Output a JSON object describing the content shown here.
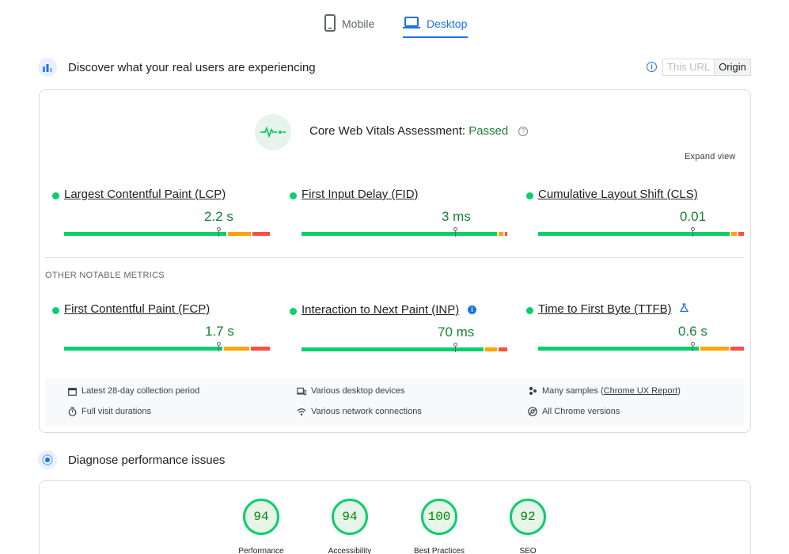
{
  "tabs": [
    {
      "label": "Mobile",
      "active": false
    },
    {
      "label": "Desktop",
      "active": true
    }
  ],
  "field": {
    "title": "Discover what your real users are experiencing",
    "toggle": {
      "url_label": "This URL",
      "origin_label": "Origin",
      "selected": "Origin"
    },
    "assessment": {
      "prefix": "Core Web Vitals Assessment: ",
      "status": "Passed"
    },
    "expand_label": "Expand view",
    "core_metrics": [
      {
        "name": "Largest Contentful Paint (LCP)",
        "value": "2.2 s",
        "status": "good"
      },
      {
        "name": "First Input Delay (FID)",
        "value": "3 ms",
        "status": "good"
      },
      {
        "name": "Cumulative Layout Shift (CLS)",
        "value": "0.01",
        "status": "good"
      }
    ],
    "other_label": "OTHER NOTABLE METRICS",
    "other_metrics": [
      {
        "name": "First Contentful Paint (FCP)",
        "value": "1.7 s",
        "status": "good"
      },
      {
        "name": "Interaction to Next Paint (INP)",
        "value": "70 ms",
        "status": "good",
        "icon": "info-icon"
      },
      {
        "name": "Time to First Byte (TTFB)",
        "value": "0.6 s",
        "status": "good",
        "icon": "experimental-flask-icon"
      }
    ],
    "footer": {
      "period": "Latest 28-day collection period",
      "devices": "Various desktop devices",
      "samples_prefix": "Many samples (",
      "samples_link": "Chrome UX Report",
      "samples_suffix": ")",
      "durations": "Full visit durations",
      "network": "Various network connections",
      "chrome": "All Chrome versions"
    }
  },
  "lab": {
    "title": "Diagnose performance issues",
    "scores": [
      {
        "label": "Performance",
        "score": "94"
      },
      {
        "label": "Accessibility",
        "score": "94"
      },
      {
        "label": "Best Practices",
        "score": "100"
      },
      {
        "label": "SEO",
        "score": "92"
      }
    ]
  },
  "colors": {
    "good": "#0cce6b",
    "needs_improvement": "#ffa400",
    "poor": "#ff4e42",
    "accent": "#1a73e8"
  }
}
